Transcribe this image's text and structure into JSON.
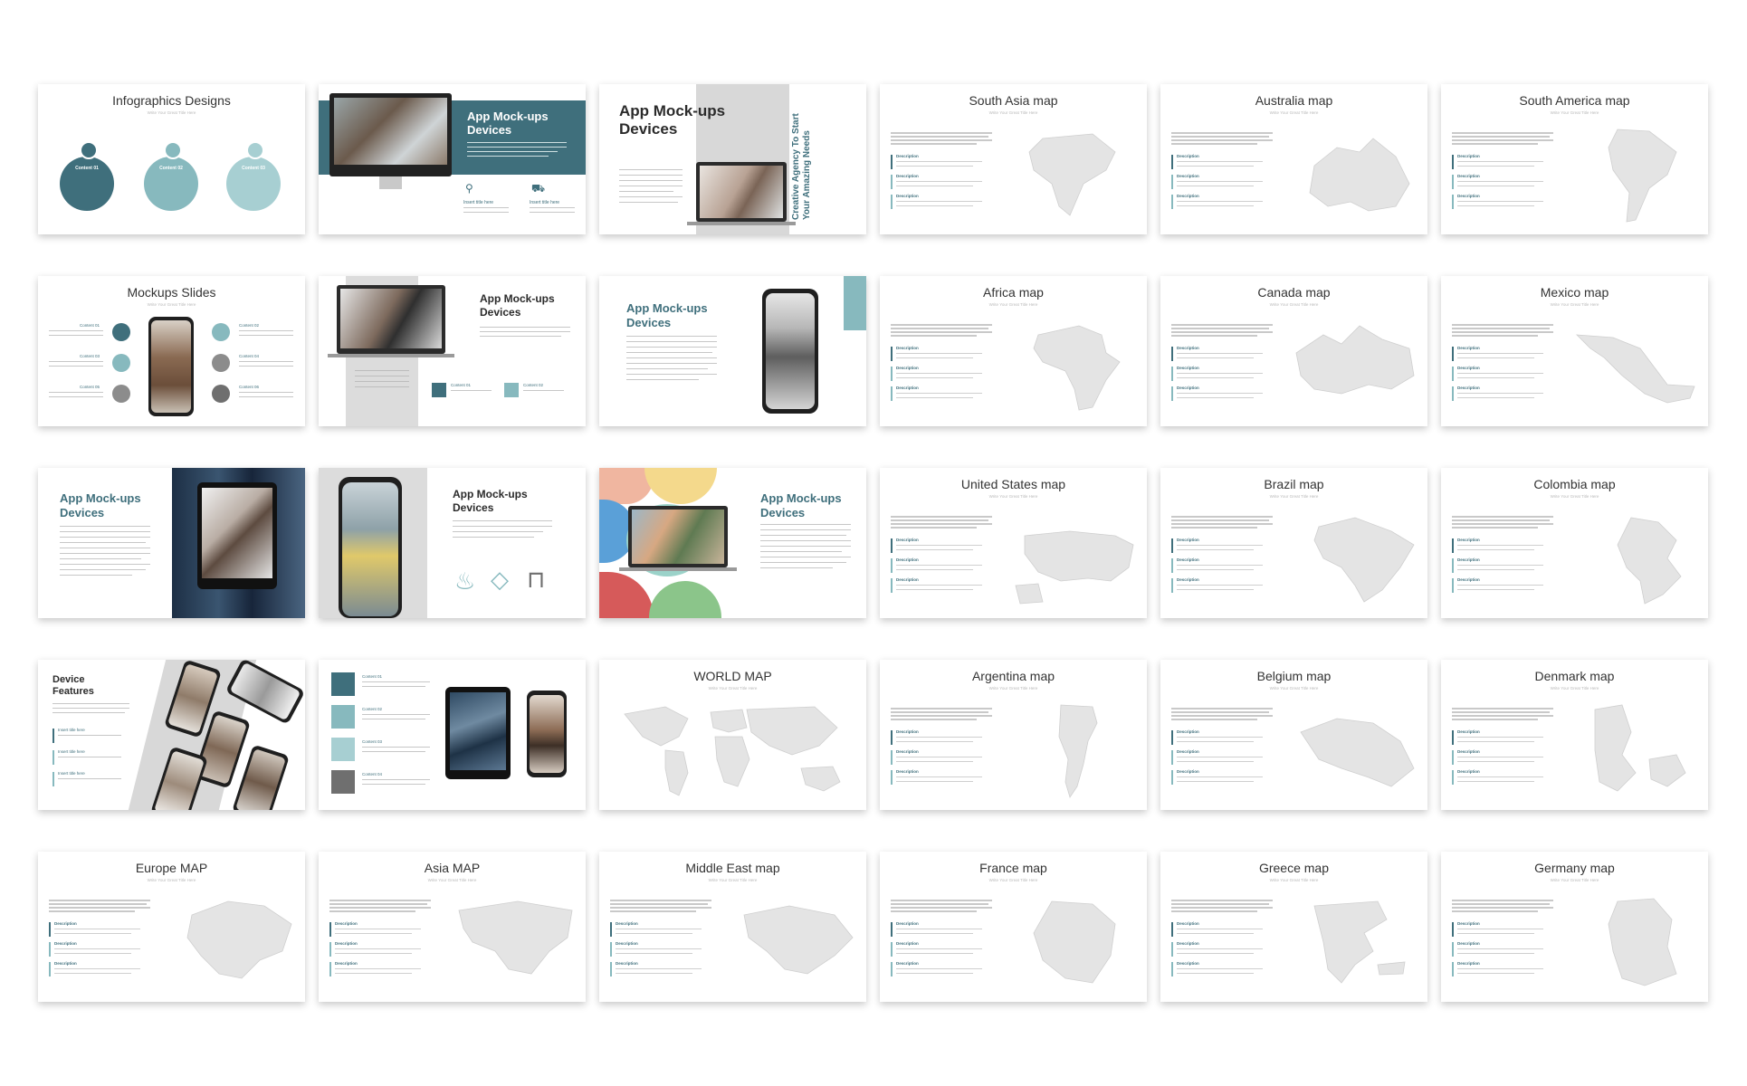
{
  "colors": {
    "teal": "#3f6f7c",
    "teal_light": "#87b9be",
    "map_fill": "#e4e4e4",
    "subtitle": "#b9b9b9"
  },
  "common": {
    "subtitle": "Write Your Great Title Here",
    "description": "Description"
  },
  "slides": [
    {
      "title": "Infographics Designs",
      "circle_label": "Content 01",
      "circle_label2": "Content 02",
      "circle_label3": "Content 03"
    },
    {
      "title": "App Mock-ups Devices",
      "col1": "Insert title here",
      "col2": "Insert title here"
    },
    {
      "title": "App Mock-ups Devices",
      "side": "Creative Agency To Start Your Amazing Needs"
    },
    {
      "title": "South Asia map"
    },
    {
      "title": "Australia map"
    },
    {
      "title": "South America map"
    },
    {
      "title": "Mockups Slides",
      "c1": "Content 01",
      "c2": "Content 02",
      "c3": "Content 03",
      "c4": "Content 04",
      "c5": "Content 05",
      "c6": "Content 06"
    },
    {
      "title": "App Mock-ups Devices",
      "c1": "Content 01",
      "c2": "Content 02"
    },
    {
      "title": "App Mock-ups Devices"
    },
    {
      "title": "Africa map"
    },
    {
      "title": "Canada map"
    },
    {
      "title": "Mexico map"
    },
    {
      "title": "App Mock-ups Devices"
    },
    {
      "title": "App Mock-ups Devices"
    },
    {
      "title": "App Mock-ups Devices"
    },
    {
      "title": "United States map"
    },
    {
      "title": "Brazil map"
    },
    {
      "title": "Colombia map"
    },
    {
      "title": "Device Features",
      "f1": "Insert title here",
      "f2": "Insert title here",
      "f3": "Insert title here"
    },
    {
      "title": "",
      "c1": "Content 01",
      "c2": "Content 02",
      "c3": "Content 03",
      "c4": "Content 04"
    },
    {
      "title": "WORLD MAP"
    },
    {
      "title": "Argentina map"
    },
    {
      "title": "Belgium map"
    },
    {
      "title": "Denmark map"
    },
    {
      "title": "Europe MAP"
    },
    {
      "title": "Asia MAP"
    },
    {
      "title": "Middle East map"
    },
    {
      "title": "France map"
    },
    {
      "title": "Greece map"
    },
    {
      "title": "Germany map"
    }
  ]
}
